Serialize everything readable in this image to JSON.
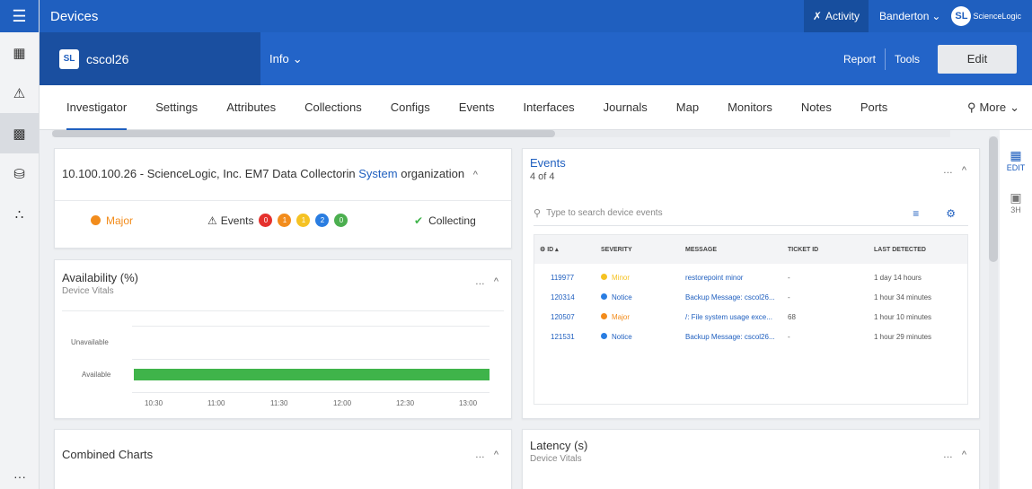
{
  "topbar": {
    "title": "Devices",
    "activity_label": "Activity",
    "user_label": "Banderton",
    "logo_mark": "SL",
    "logo_text": "ScienceLogic"
  },
  "device": {
    "logo_mark": "SL",
    "name": "cscol26",
    "info_label": "Info",
    "report_label": "Report",
    "tools_label": "Tools",
    "edit_label": "Edit"
  },
  "tabs": [
    {
      "label": "Investigator",
      "active": true
    },
    {
      "label": "Settings"
    },
    {
      "label": "Attributes"
    },
    {
      "label": "Collections"
    },
    {
      "label": "Configs"
    },
    {
      "label": "Events"
    },
    {
      "label": "Interfaces"
    },
    {
      "label": "Journals"
    },
    {
      "label": "Map"
    },
    {
      "label": "Monitors"
    },
    {
      "label": "Notes"
    },
    {
      "label": "Ports"
    }
  ],
  "more_label": "More",
  "info_panel": {
    "title_prefix": "10.100.100.26 - ScienceLogic, Inc. EM7 Data Collectorin",
    "title_link": "System",
    "title_suffix": "organization",
    "severity": "Major",
    "events_label": "Events",
    "event_counts": [
      {
        "value": "0",
        "color": "#e5312d"
      },
      {
        "value": "1",
        "color": "#f28c1c"
      },
      {
        "value": "1",
        "color": "#f5c223"
      },
      {
        "value": "2",
        "color": "#2a7de1"
      },
      {
        "value": "0",
        "color": "#4caf50"
      }
    ],
    "status": "Collecting"
  },
  "availability_panel": {
    "title": "Availability (%)",
    "subtitle": "Device Vitals",
    "y_labels": [
      "Unavailable",
      "Available"
    ],
    "x_labels": [
      "10:30",
      "11:00",
      "11:30",
      "12:00",
      "12:30",
      "13:00"
    ]
  },
  "events_panel": {
    "title": "Events",
    "count": "4 of 4",
    "search_placeholder": "Type to search device events",
    "headers": {
      "id": "ID",
      "severity": "SEVERITY",
      "message": "MESSAGE",
      "ticket": "TICKET ID",
      "last": "LAST DETECTED"
    },
    "rows": [
      {
        "id": "119977",
        "severity": "Minor",
        "sev_color": "#f5c223",
        "message": "restorepoint minor",
        "ticket": "-",
        "last": "1 day 14 hours"
      },
      {
        "id": "120314",
        "severity": "Notice",
        "sev_color": "#2a7de1",
        "message": "Backup Message: cscol26...",
        "ticket": "-",
        "last": "1 hour 34 minutes"
      },
      {
        "id": "120507",
        "severity": "Major",
        "sev_color": "#f28c1c",
        "message": "/: File system usage exce...",
        "ticket": "68",
        "last": "1 hour 10 minutes"
      },
      {
        "id": "121531",
        "severity": "Notice",
        "sev_color": "#2a7de1",
        "message": "Backup Message: cscol26...",
        "ticket": "-",
        "last": "1 hour 29 minutes"
      }
    ]
  },
  "combined_panel": {
    "title": "Combined Charts"
  },
  "latency_panel": {
    "title": "Latency (s)",
    "subtitle": "Device Vitals"
  },
  "right_rail": {
    "edit_label": "EDIT",
    "range_label": "3H"
  },
  "panel_controls": {
    "more": "…",
    "collapse": "^"
  }
}
